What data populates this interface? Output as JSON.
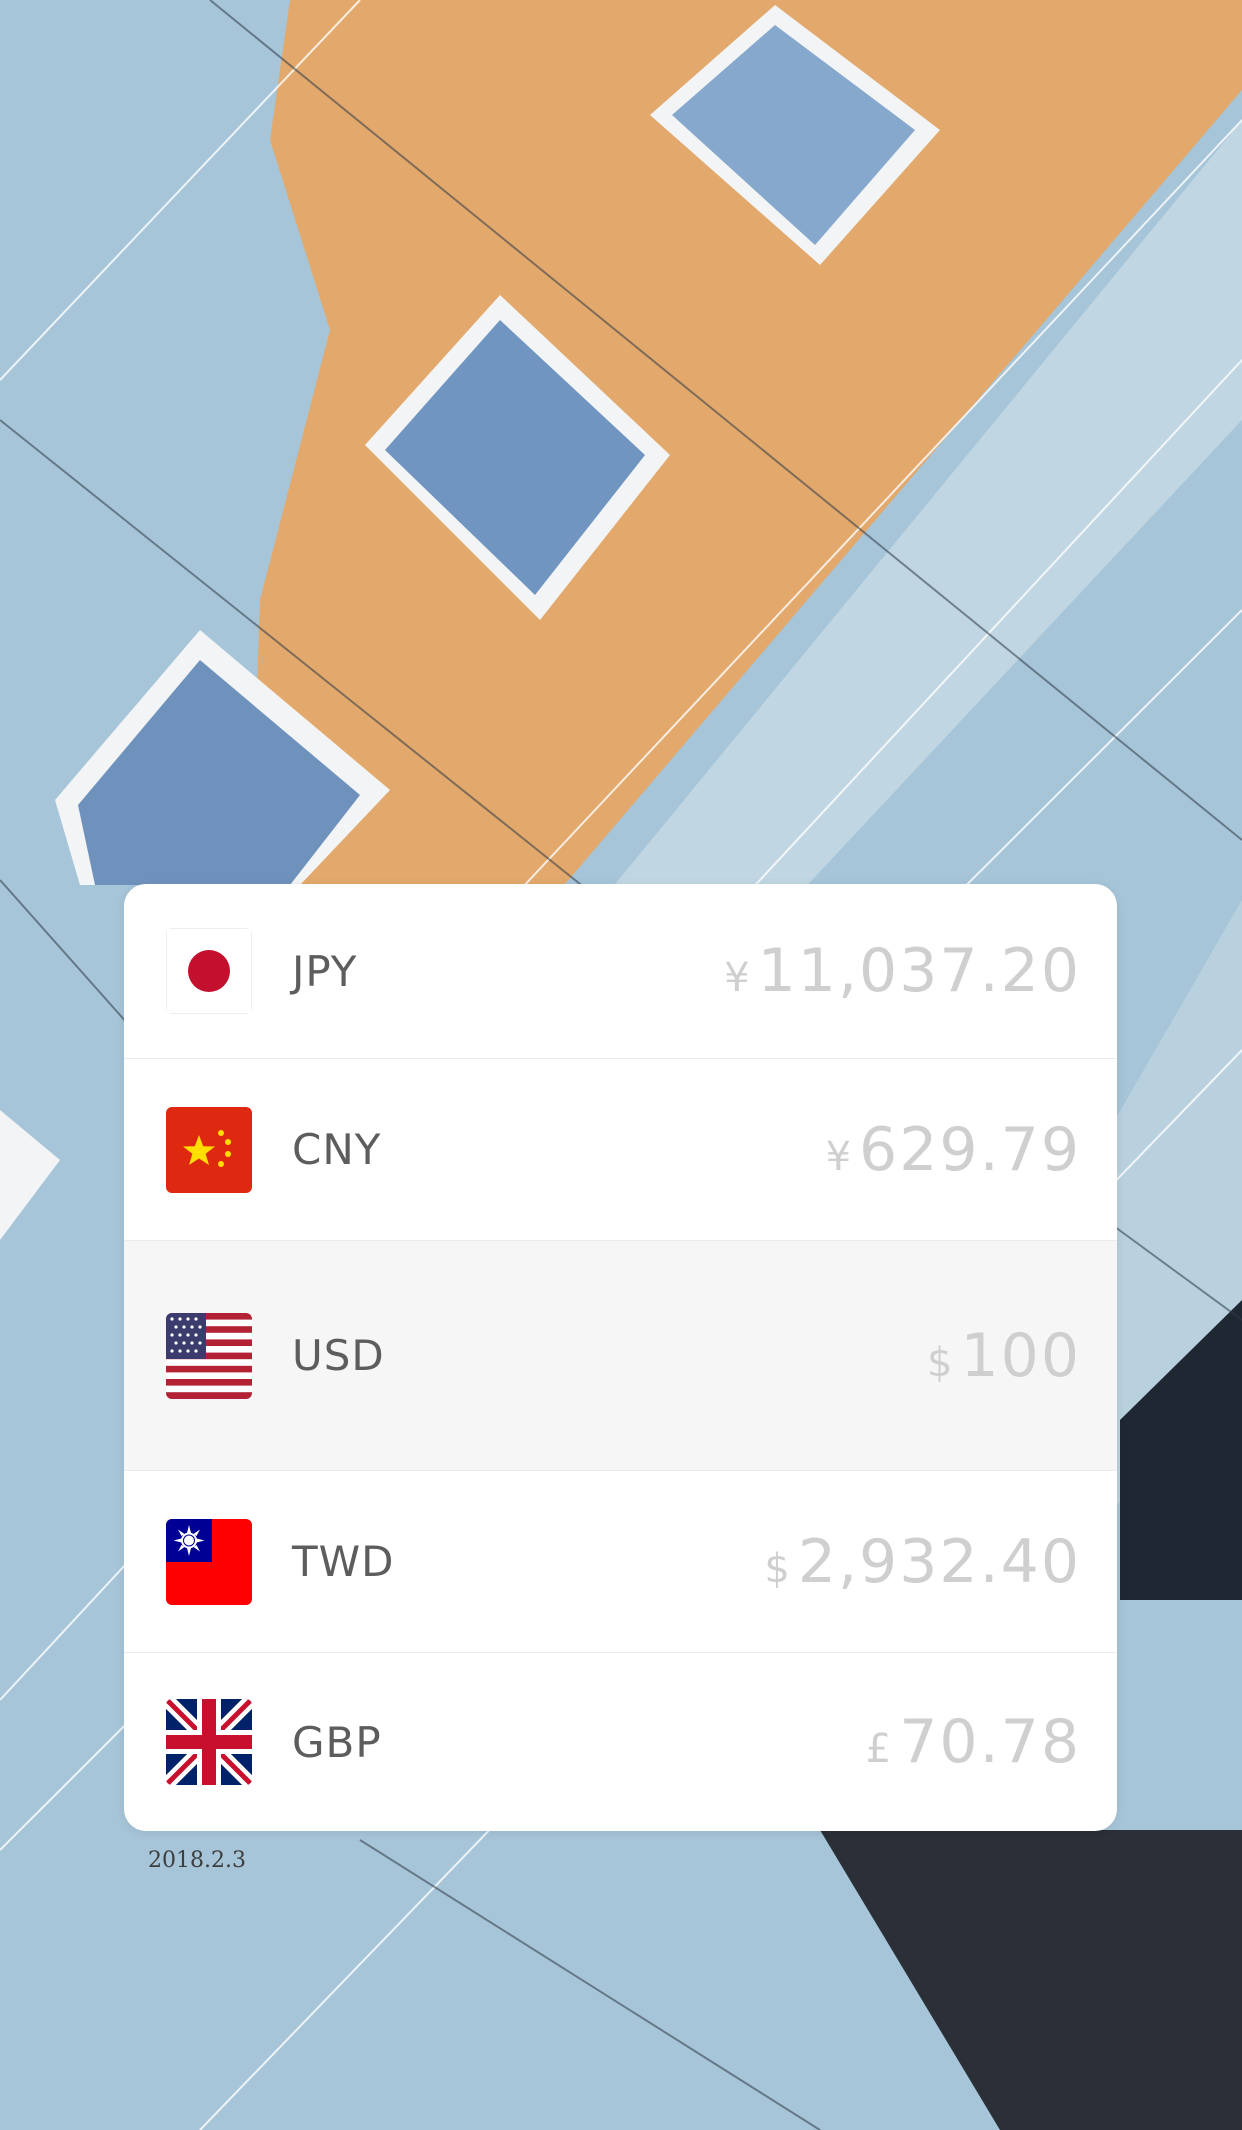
{
  "currencies": [
    {
      "code": "JPY",
      "symbol": "¥",
      "amount": "11,037.20",
      "flag": "japan-flag-icon",
      "selected": false
    },
    {
      "code": "CNY",
      "symbol": "¥",
      "amount": "629.79",
      "flag": "china-flag-icon",
      "selected": false
    },
    {
      "code": "USD",
      "symbol": "$",
      "amount": "100",
      "flag": "usa-flag-icon",
      "selected": true
    },
    {
      "code": "TWD",
      "symbol": "$",
      "amount": "2,932.40",
      "flag": "taiwan-flag-icon",
      "selected": false
    },
    {
      "code": "GBP",
      "symbol": "£",
      "amount": "70.78",
      "flag": "uk-flag-icon",
      "selected": false
    }
  ],
  "rate_date": "2018.2.3",
  "colors": {
    "background_photo_blue": "#a9c7d9",
    "background_photo_orange": "#e3a76a",
    "amount_text": "#cfcfcf",
    "code_text": "#5d5d5d"
  }
}
